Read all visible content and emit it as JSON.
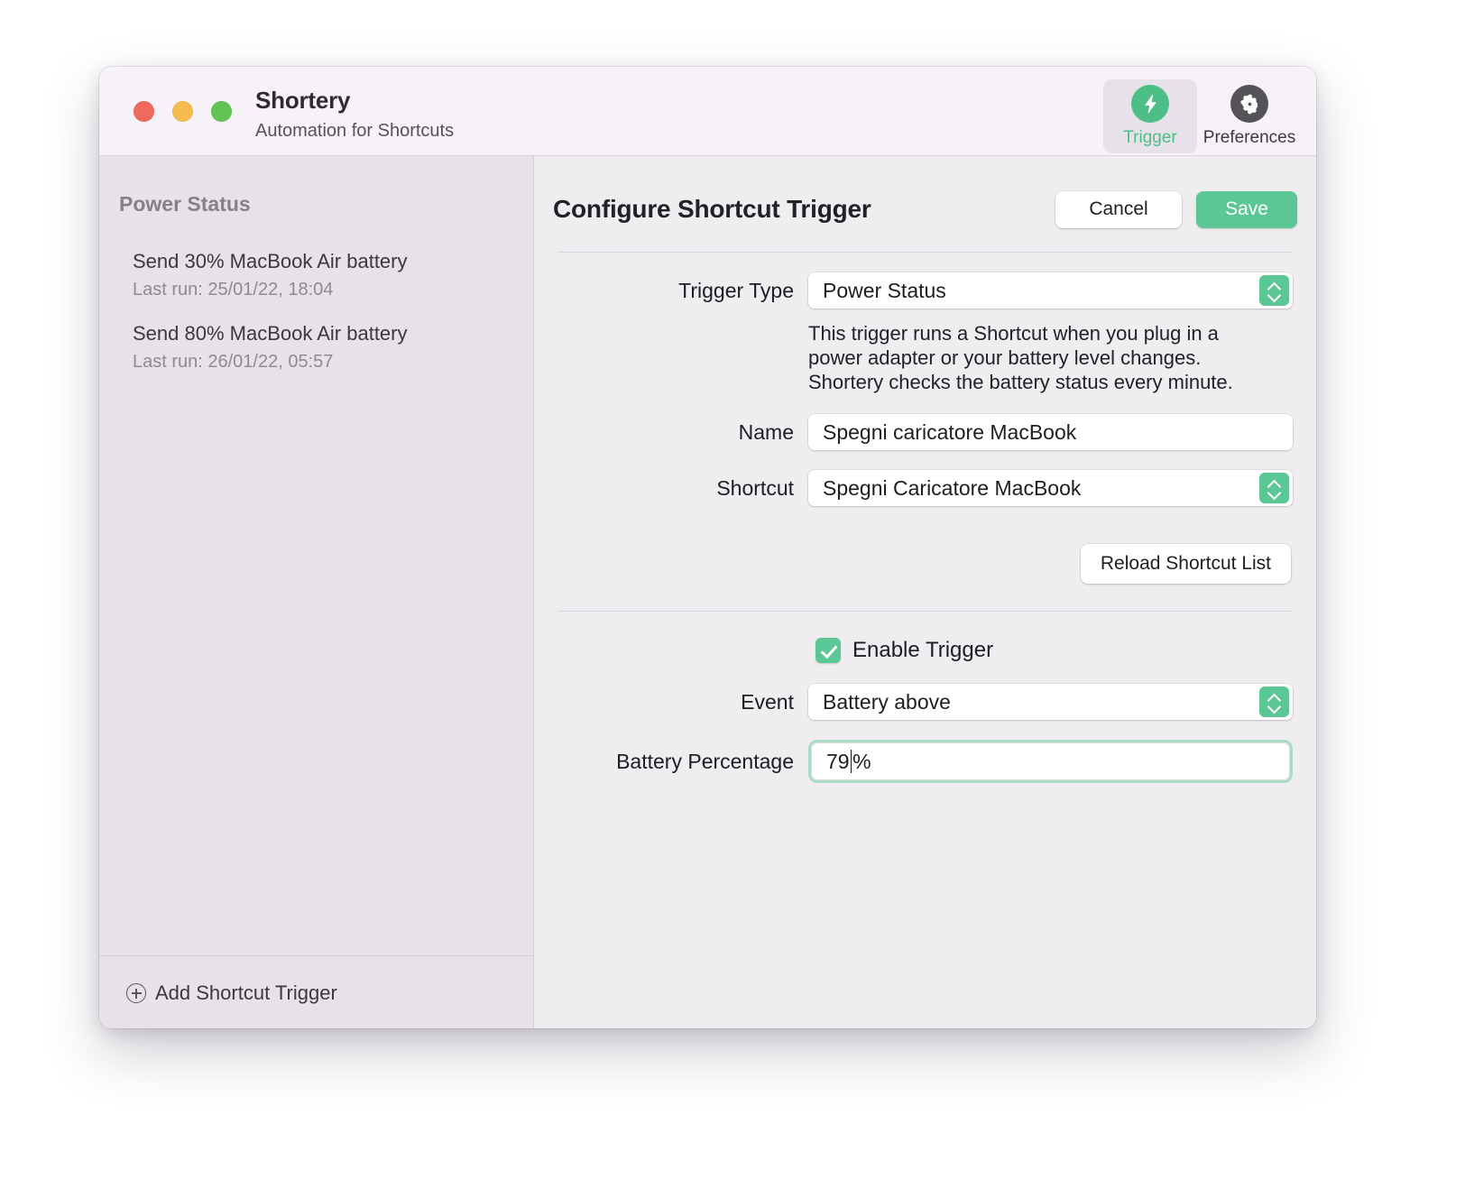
{
  "window": {
    "app_title": "Shortery",
    "app_subtitle": "Automation for Shortcuts"
  },
  "toolbar": {
    "items": [
      {
        "label": "Trigger",
        "icon": "lightning-bolt-icon",
        "selected": true
      },
      {
        "label": "Preferences",
        "icon": "gear-icon",
        "selected": false
      }
    ]
  },
  "sidebar": {
    "section_header": "Power Status",
    "triggers": [
      {
        "name": "Send 30% MacBook Air battery",
        "last_run": "Last run: 25/01/22, 18:04"
      },
      {
        "name": "Send 80% MacBook Air battery",
        "last_run": "Last run: 26/01/22, 05:57"
      }
    ],
    "add_button": "Add Shortcut Trigger"
  },
  "main": {
    "title": "Configure Shortcut Trigger",
    "cancel_label": "Cancel",
    "save_label": "Save",
    "trigger_type_label": "Trigger Type",
    "trigger_type_value": "Power Status",
    "helper_text": "This trigger runs a Shortcut when you plug in a power adapter or your battery level changes. Shortery checks the battery status every minute.",
    "name_label": "Name",
    "name_value": "Spegni caricatore MacBook",
    "shortcut_label": "Shortcut",
    "shortcut_value": "Spegni Caricatore MacBook",
    "reload_label": "Reload Shortcut List",
    "enable_trigger_label": "Enable Trigger",
    "enable_trigger_checked": true,
    "event_label": "Event",
    "event_value": "Battery above",
    "battery_percentage_label": "Battery Percentage",
    "battery_percentage_value": "79",
    "battery_percentage_suffix": "%"
  },
  "colors": {
    "accent_green": "#5bc795",
    "icon_green": "#4dbe85",
    "focus_ring": "#a8ddc3",
    "titlebar": "#f6f2f7",
    "sidebar": "#e6e2e7",
    "main_bg": "#efedf0"
  }
}
